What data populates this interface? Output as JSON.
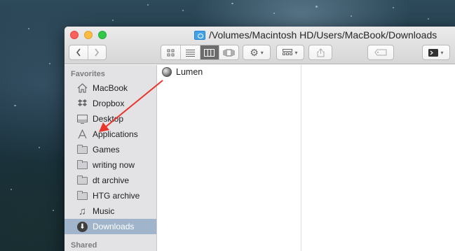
{
  "window": {
    "title": "/Volumes/Macintosh HD/Users/MacBook/Downloads"
  },
  "toolbar": {
    "back_icon": "chevron-left-icon",
    "forward_icon": "chevron-right-icon",
    "view_modes": [
      "icon-view",
      "list-view",
      "column-view",
      "cover-flow-view"
    ],
    "active_view": "column-view",
    "action_icon": "gear-icon",
    "arrange_icon": "arrange-grid-icon",
    "share_icon": "share-icon",
    "tags_icon": "tag-icon",
    "terminal_icon": "terminal-icon"
  },
  "sidebar": {
    "favorites_heading": "Favorites",
    "items": [
      {
        "label": "MacBook",
        "icon": "home-icon"
      },
      {
        "label": "Dropbox",
        "icon": "dropbox-icon"
      },
      {
        "label": "Desktop",
        "icon": "desktop-icon"
      },
      {
        "label": "Applications",
        "icon": "applications-icon"
      },
      {
        "label": "Games",
        "icon": "folder-icon"
      },
      {
        "label": "writing now",
        "icon": "folder-icon"
      },
      {
        "label": "dt archive",
        "icon": "folder-icon"
      },
      {
        "label": "HTG archive",
        "icon": "folder-icon"
      },
      {
        "label": "Music",
        "icon": "music-icon"
      },
      {
        "label": "Downloads",
        "icon": "downloads-icon",
        "selected": true
      }
    ],
    "shared_heading": "Shared"
  },
  "column1": {
    "items": [
      {
        "label": "Lumen",
        "icon": "lumen-app-icon"
      }
    ]
  },
  "annotation": {
    "arrow_color": "#e8352b"
  },
  "colors": {
    "selection": "#a0b4cb",
    "sidebar_bg": "#e3e3e6"
  }
}
